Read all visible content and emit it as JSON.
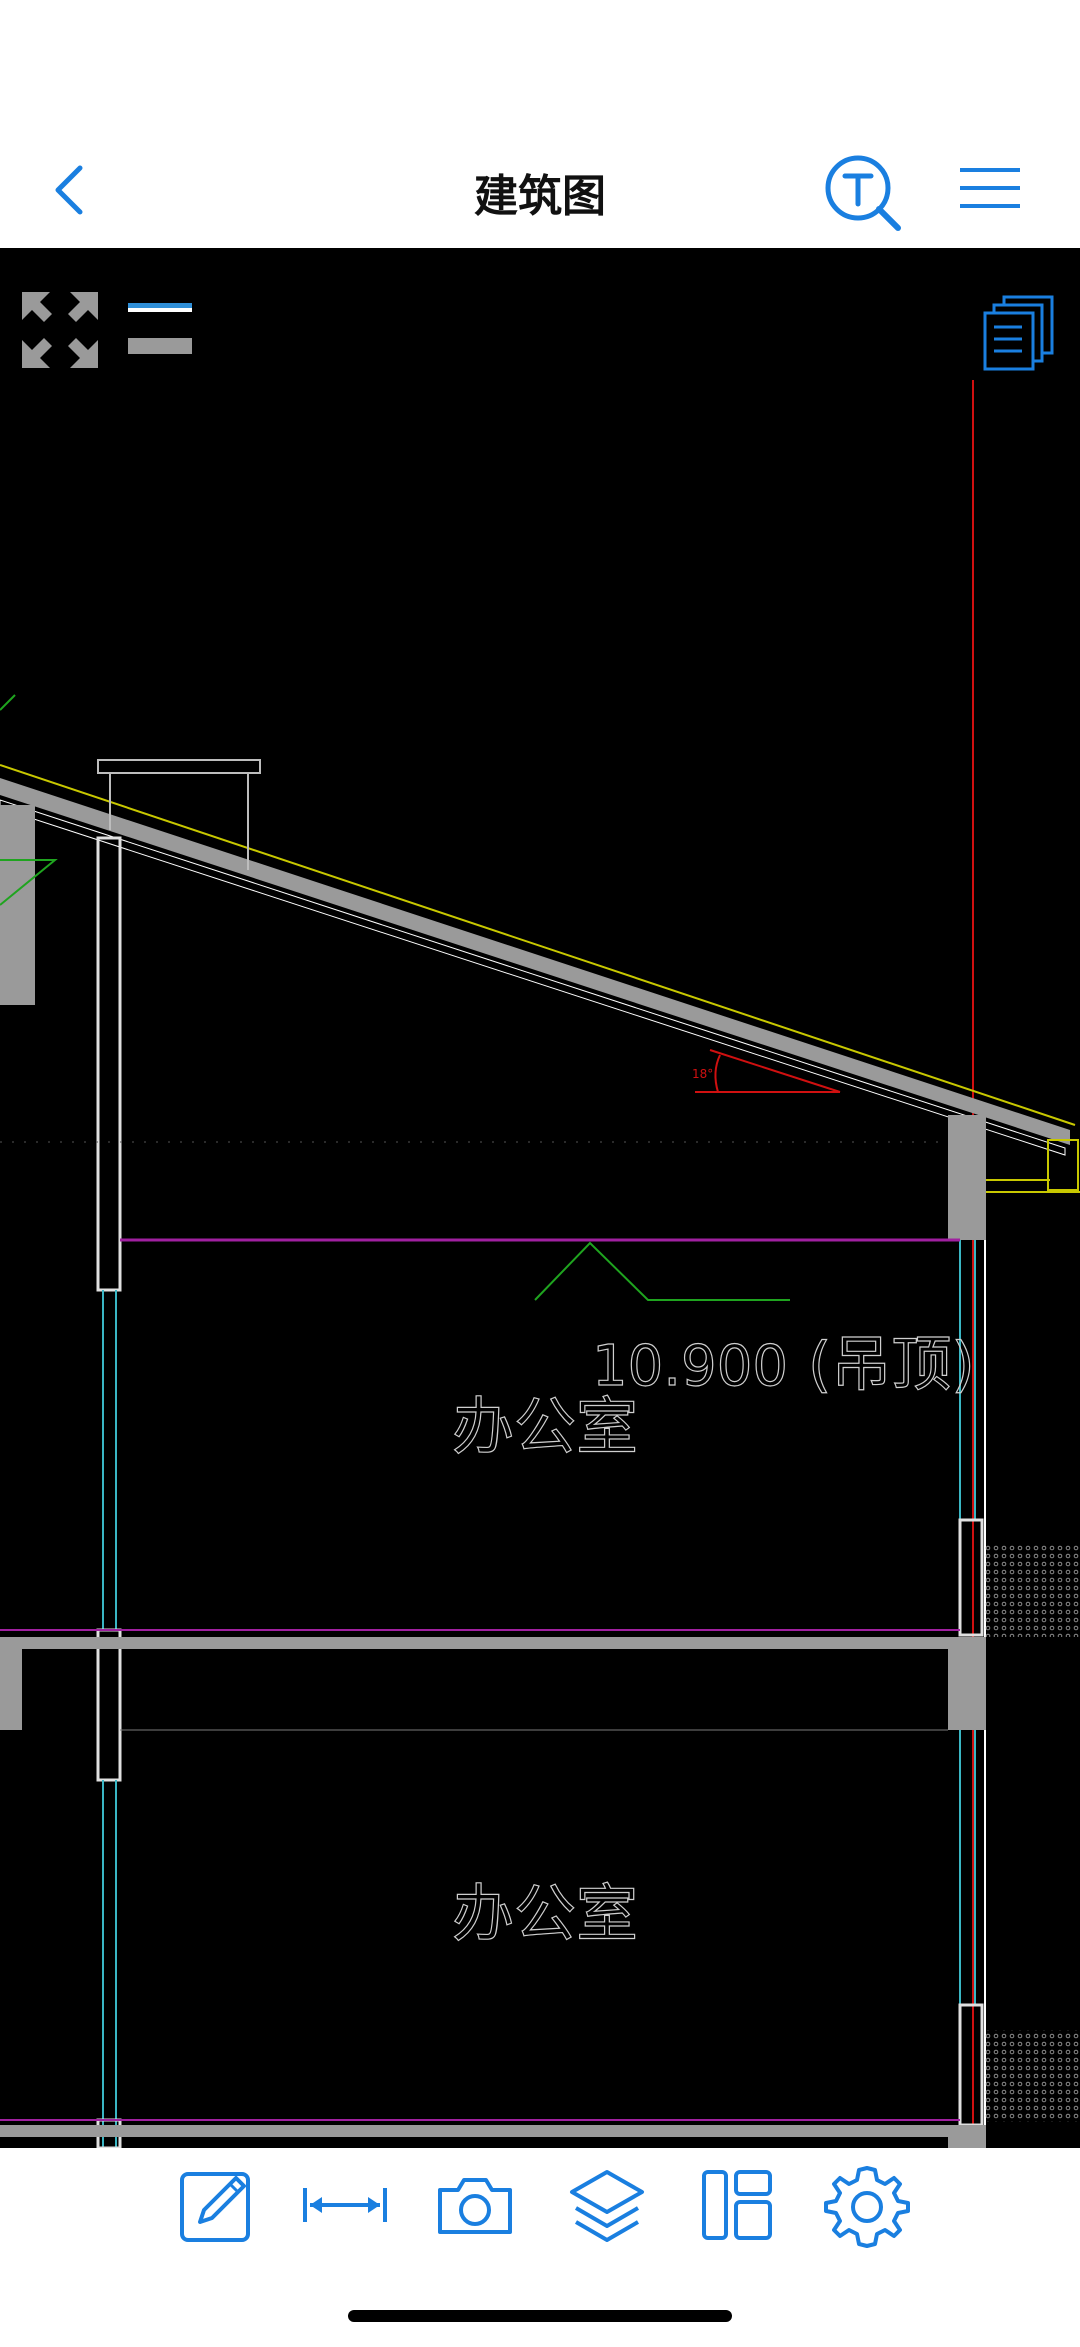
{
  "header": {
    "title": "建筑图"
  },
  "drawing": {
    "rooms": [
      {
        "label": "办公室"
      },
      {
        "label": "办公室"
      }
    ],
    "elevation": "10.900",
    "ceiling_note": "(吊顶)",
    "slope_note": "18°"
  },
  "icons": {
    "back": "chevron-left-icon",
    "search": "text-search-icon",
    "menu": "hamburger-menu-icon",
    "fit": "expand-arrows-icon",
    "layers_toggle": "line-toggle-icon",
    "pages": "document-stack-icon",
    "edit": "pencil-edit-icon",
    "measure": "measure-icon",
    "camera": "camera-icon",
    "layers": "layers-icon",
    "layout": "layout-icon",
    "settings": "gear-icon"
  },
  "colors": {
    "accent": "#1a7fe0",
    "canvas": "#000000",
    "wall": "#9a9a9a",
    "magenta": "#a020a0",
    "green": "#1fa41f",
    "yellow": "#c8c800",
    "red": "#d01010",
    "cyan": "#3ab6c4"
  }
}
